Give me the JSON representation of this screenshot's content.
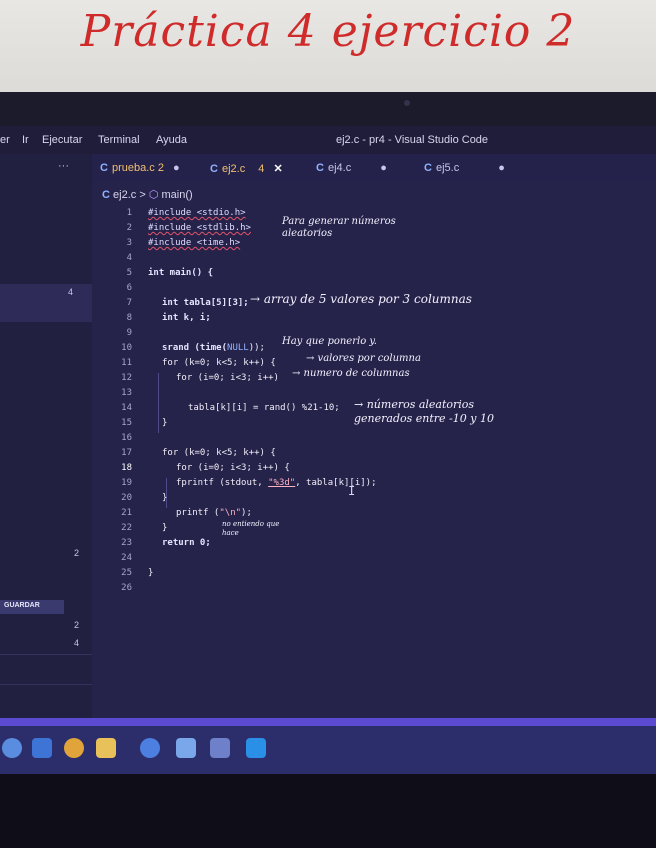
{
  "paper": {
    "title": "Práctica 4 ejercicio 2"
  },
  "menubar": {
    "items": [
      "er",
      "Ir",
      "Ejecutar",
      "Terminal",
      "Ayuda"
    ],
    "window_title": "ej2.c - pr4 - Visual Studio Code"
  },
  "sidebar": {
    "more": "···",
    "badges": [
      "4",
      "2",
      "2",
      "4"
    ],
    "save_label": "GUARDAR"
  },
  "tabs": [
    {
      "icon": "C",
      "name": "prueba.c",
      "badge": "2",
      "marker": "●"
    },
    {
      "icon": "C",
      "name": "ej2.c",
      "badge": "4",
      "marker": "✕"
    },
    {
      "icon": "C",
      "name": "ej4.c",
      "badge": "",
      "marker": "●"
    },
    {
      "icon": "C",
      "name": "ej5.c",
      "badge": "",
      "marker": "●"
    }
  ],
  "breadcrumb": {
    "file": "ej2.c",
    "separator": ">",
    "symbol": "main()"
  },
  "editor": {
    "line_numbers": [
      "1",
      "2",
      "3",
      "4",
      "5",
      "6",
      "7",
      "8",
      "9",
      "10",
      "11",
      "12",
      "13",
      "14",
      "15",
      "16",
      "17",
      "18",
      "19",
      "20",
      "21",
      "22",
      "23",
      "24",
      "25",
      "26"
    ],
    "current_line": "18",
    "lines": {
      "l1": "#include <stdio.h>",
      "l2": "#include <stdlib.h>",
      "l3": "#include <time.h>",
      "l5": "int main() {",
      "l7": "int tabla[5][3];",
      "l8": "int k, i;",
      "l10a": "srand (time(",
      "l10b": "NULL",
      "l10c": "));",
      "l11": "for (k=0; k<5; k++) {",
      "l12": "for (i=0; i<3; i++)",
      "l14": "tabla[k][i] = rand() %21-10;",
      "l15": "}",
      "l17": "for (k=0; k<5; k++) {",
      "l18": "for (i=0; i<3; i++) {",
      "l19a": "fprintf (stdout, ",
      "l19b": "\"%3d\"",
      "l19c": ", tabla[k][i]);",
      "l20": "}",
      "l21a": "printf (",
      "l21b": "\"\\n\"",
      "l21c": ");",
      "l22": "}",
      "l23": "return 0;",
      "l25": "}"
    }
  },
  "notes": {
    "includes": "Para generar números aleatorios",
    "array": "→ array de 5 valores por 3 columnas",
    "srand": "Hay que ponerlo y.",
    "for_k": "→ valores por columna",
    "for_i": "→ numero de columnas",
    "rand": "→ números aleatorios generados entre -10 y 10",
    "printf": "no entiendo que hace"
  },
  "colors": {
    "accent": "#5b4bd3",
    "editor_bg": "#26234a",
    "annotation_red": "#cf2b2b"
  }
}
